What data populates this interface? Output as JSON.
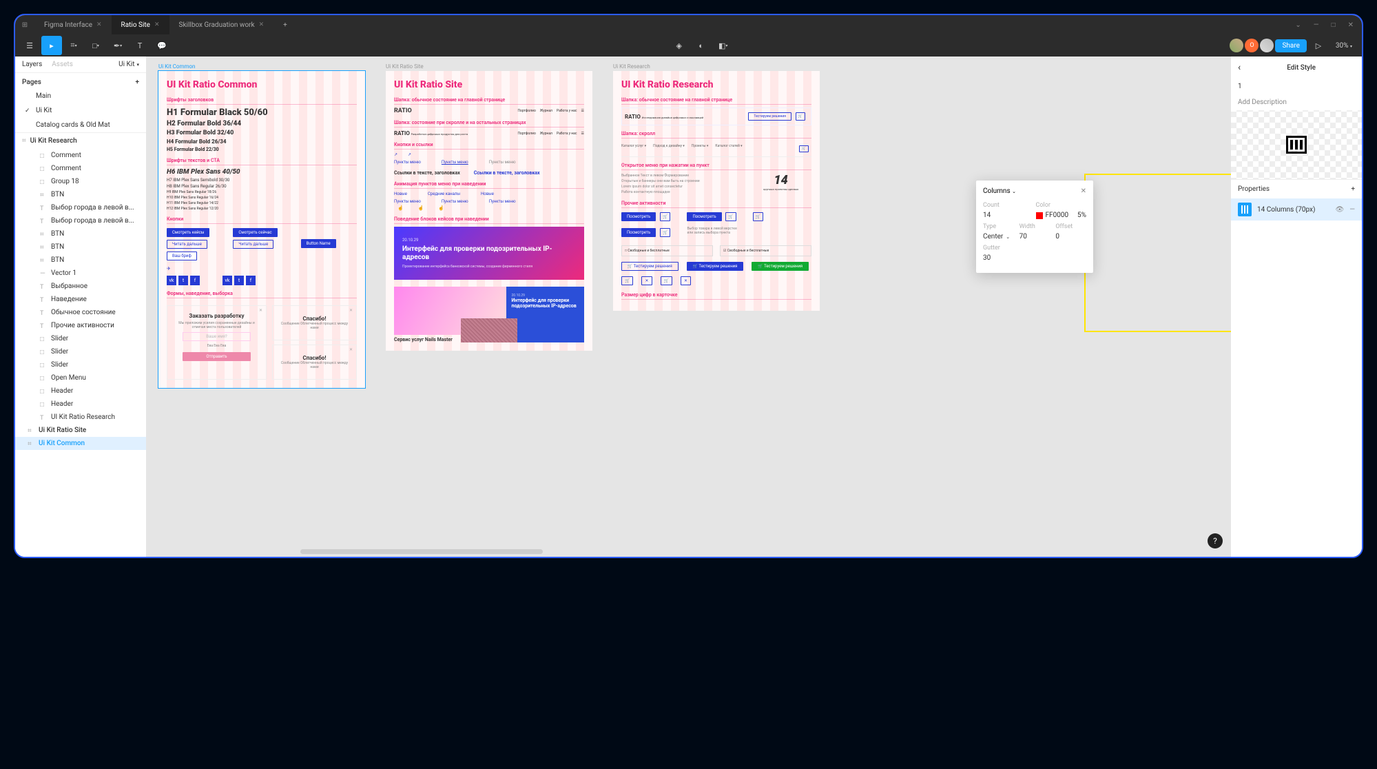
{
  "titlebar": {
    "tabs": [
      "Figma Interface",
      "Ratio Site",
      "Skillbox Graduation work"
    ],
    "active_tab": 1
  },
  "toolbar": {
    "zoom": "30%",
    "share": "Share"
  },
  "left_panel": {
    "tab_layers": "Layers",
    "tab_assets": "Assets",
    "page_dropdown": "Ui Kit",
    "pages_label": "Pages",
    "pages": [
      "Main",
      "Ui Kit",
      "Catalog cards & Old Mat"
    ],
    "active_page": 1,
    "section_header": "Ui Kit Research",
    "layers": [
      {
        "icon": "rect",
        "label": "Comment"
      },
      {
        "icon": "rect",
        "label": "Comment"
      },
      {
        "icon": "rect",
        "label": "Group 18"
      },
      {
        "icon": "frame",
        "label": "BTN"
      },
      {
        "icon": "text",
        "label": "Выбор города в левой в..."
      },
      {
        "icon": "text",
        "label": "Выбор города в левой в..."
      },
      {
        "icon": "frame",
        "label": "BTN"
      },
      {
        "icon": "frame",
        "label": "BTN"
      },
      {
        "icon": "frame",
        "label": "BTN"
      },
      {
        "icon": "vector",
        "label": "Vector 1"
      },
      {
        "icon": "text",
        "label": "Выбранное"
      },
      {
        "icon": "text",
        "label": "Наведение"
      },
      {
        "icon": "text",
        "label": "Обычное состояние"
      },
      {
        "icon": "text",
        "label": "Прочие активности"
      },
      {
        "icon": "rect",
        "label": "Slider"
      },
      {
        "icon": "rect",
        "label": "Slider"
      },
      {
        "icon": "rect",
        "label": "Slider"
      },
      {
        "icon": "rect",
        "label": "Open Menu"
      },
      {
        "icon": "rect",
        "label": "Header"
      },
      {
        "icon": "rect",
        "label": "Header"
      },
      {
        "icon": "text",
        "label": "UI Kit Ratio Research"
      }
    ],
    "root_frames": [
      "Ui Kit Ratio Site",
      "Ui Kit Common"
    ],
    "active_root": 1
  },
  "artboards": {
    "a1": {
      "label": "Ui Kit Common",
      "title": "UI Kit Ratio Common",
      "sec_fonts_title": "Шрифты заголовков",
      "h1": "H1 Formular Black 50/60",
      "h2": "H2 Formular Bold 36/44",
      "h3": "H3 Formular Bold 32/40",
      "h4": "H4 Formular Bold 26/34",
      "h5": "H5 Formular Bold 22/30",
      "sec_text_cta": "Шрифты текстов и СТА",
      "h6": "H6 IBM Plex Sans 40/50",
      "ibm1": "H7 IBM Plex Sans Semibold 30/30",
      "ibm2": "H8 IBM Plex Sans Regular 26/30",
      "ibm3": "H9 IBM Plex Sans Regular 18/26",
      "ibm4": "H10 IBM Plex Sans Regular 16/24",
      "ibm5": "H11 IBM Plex Sans Regular 14/22",
      "ibm6": "H12 IBM Plex Sans Regular 12/20",
      "sec_buttons": "Кнопки",
      "btn1": "Смотреть кейсы",
      "btn2": "Читать дальше",
      "btn3": "Ваш бриф",
      "btn4": "Смотреть сейчас",
      "btn5": "Читать дальше",
      "btn6": "Button Name",
      "sec_forms": "Формы, наведение, выборка",
      "form_title": "Заказать разработку",
      "form_sub": "Мы приложим усилия сохраненные дизайны и отмечая места пользователей",
      "form_ph": "Ваше имя?",
      "form_note": "Ева Ева Ева",
      "thanks": "Спасибо!",
      "thanks_sub": "Сообщение Облегченный процесс между нами"
    },
    "a2": {
      "label": "Ui Kit Ratio Site",
      "title": "UI Kit Ratio Site",
      "sec_header": "Шапка: обычное состояние на главной странице",
      "logo": "RATIO",
      "nav1": "Портфолио",
      "nav2": "Журнал",
      "nav3": "Работа у нас",
      "sec_header2": "Шапка: состояние при скролле и на остальных страницах",
      "logo_sub": "Разработка цифровых продуктов для роста",
      "sec_links": "Кнопки и ссылки",
      "link1": "Пункты меню",
      "link2": "Пункты меню",
      "link3": "Пункты меню",
      "sec_text_links": "Ссылки в тексте, заголовках",
      "text_link": "Ссылки в тексте, заголовках",
      "sec_anim": "Анимация пунктов меню при наведении",
      "menu_a": "Новые",
      "menu_b": "Средние каналы",
      "menu_c": "Новые",
      "pm1": "Пункты меню",
      "pm2": "Пункты меню",
      "pm3": "Пункты меню",
      "sec_hover": "Поведение блоков кейсов при наведении",
      "case_date": "20.10.29",
      "case_title": "Интерфейс для проверки подозрительных IP-адресов",
      "case_sub": "Проектирование интерфейса банковской системы, создание фирменного стиля",
      "svc_title": "Сервис услуг Nails Master",
      "side_date": "20.10.29",
      "side_title": "Интерфейс для проверки подозрительных IP-адресов"
    },
    "a3": {
      "label": "Ui Kit Research",
      "title": "UI Kit Ratio Research",
      "sec_header": "Шапка: обычное состояние на главной странице",
      "logo": "RATIO",
      "logo_sub": "Исследования дизайна цифровых и инноваций",
      "btn_sol": "Тестируем решения",
      "sec_scroll": "Шапка: скролл",
      "sec_menu": "Открытое меню при нажатии на пункт",
      "big14": "14",
      "sec_activity": "Прочие активности",
      "btn_view": "Посмотреть",
      "btn_view2": "Посмотреть",
      "sec_digits": "Размер цифр в карточке"
    }
  },
  "right_panel": {
    "title": "Edit Style",
    "field_num": "1",
    "add_desc": "Add Description",
    "properties": "Properties",
    "prop_label": "14 Columns (70px)"
  },
  "columns_popup": {
    "title": "Columns",
    "count_label": "Count",
    "count": "14",
    "color_label": "Color",
    "color_hex": "FF0000",
    "color_pct": "5%",
    "type_label": "Type",
    "type": "Center",
    "width_label": "Width",
    "width": "70",
    "offset_label": "Offset",
    "offset": "0",
    "gutter_label": "Gutter",
    "gutter": "30"
  }
}
